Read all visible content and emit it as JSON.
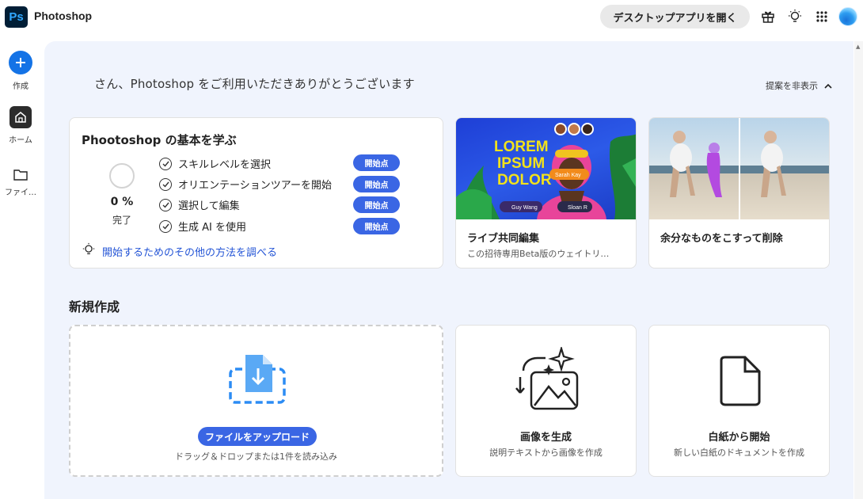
{
  "app": {
    "logo_text": "Ps",
    "title": "Photoshop"
  },
  "topbar": {
    "open_desktop_label": "デスクトップアプリを開く",
    "icons": [
      "gift-icon",
      "lightbulb-icon",
      "apps-grid-icon"
    ],
    "accent": "#1473e6"
  },
  "rail": {
    "items": [
      {
        "label": "作成",
        "icon": "plus-icon"
      },
      {
        "label": "ホーム",
        "icon": "home-icon"
      },
      {
        "label": "ファイ…",
        "icon": "folder-icon"
      }
    ]
  },
  "main": {
    "greeting": "さん、Photoshop をご利用いただきありがとうございます",
    "hide_suggestions": "提案を非表示"
  },
  "learn": {
    "title": "Phootoshop の基本を学ぶ",
    "progress_value": 0,
    "progress_percent": "0 %",
    "progress_label": "完了",
    "tasks": [
      {
        "label": "スキルレベルを選択",
        "button": "開始点"
      },
      {
        "label": "オリエンテーションツアーを開始",
        "button": "開始点"
      },
      {
        "label": "選択して編集",
        "button": "開始点"
      },
      {
        "label": "生成 AI を使用",
        "button": "開始点"
      }
    ],
    "more_link": "開始するためのその他の方法を調べる"
  },
  "promo_cards": [
    {
      "title": "ライブ共同編集",
      "subtitle": "この招待専用Beta版のウェイトリ…",
      "thumb_text": [
        "LOREM",
        "IPSUM",
        "DOLOR"
      ],
      "tags": [
        "Sarah Kay",
        "Guy Wang",
        "Sloan R"
      ]
    },
    {
      "title": "余分なものをこすって削除",
      "subtitle": ""
    }
  ],
  "new_section": {
    "title": "新規作成",
    "upload": {
      "button": "ファイルをアップロード",
      "subtitle": "ドラッグ＆ドロップまたは1件を読み込み"
    },
    "generate": {
      "title": "画像を生成",
      "subtitle": "説明テキストから画像を作成"
    },
    "blank": {
      "title": "白紙から開始",
      "subtitle": "新しい白紙のドキュメントを作成"
    }
  }
}
